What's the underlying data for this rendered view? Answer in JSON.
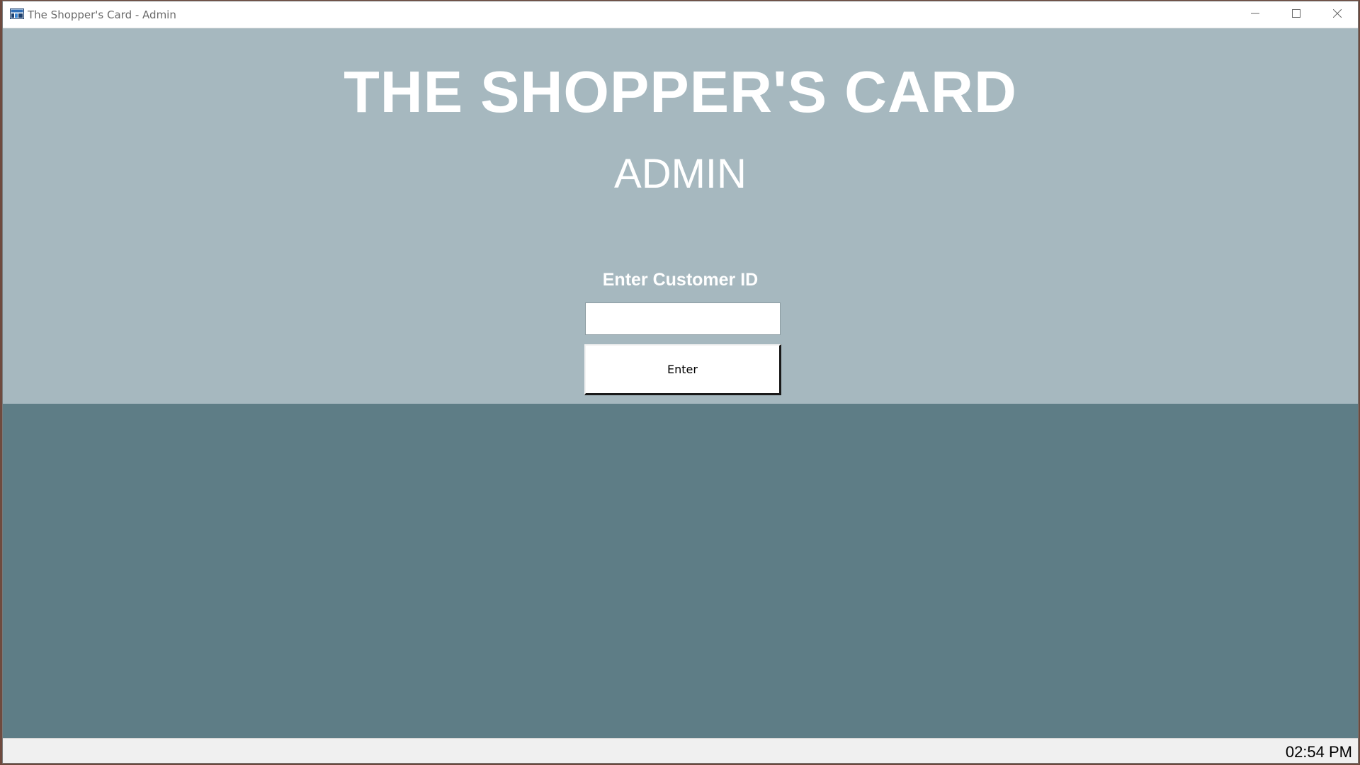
{
  "window": {
    "title": "The Shopper's Card - Admin"
  },
  "icons": {
    "app": "app-logo-icon",
    "minimize": "minimize-icon",
    "maximize": "maximize-icon",
    "close": "close-icon"
  },
  "header": {
    "title": "THE SHOPPER'S CARD",
    "subtitle": "ADMIN"
  },
  "form": {
    "label": "Enter Customer ID",
    "input_value": "",
    "button_label": "Enter"
  },
  "status_bar": {
    "time": "02:54 PM"
  },
  "colors": {
    "top_panel": "#a6b8bf",
    "bottom_panel": "#5e7d86",
    "status_bar": "#f0f0f0",
    "title_text": "#ffffff"
  }
}
